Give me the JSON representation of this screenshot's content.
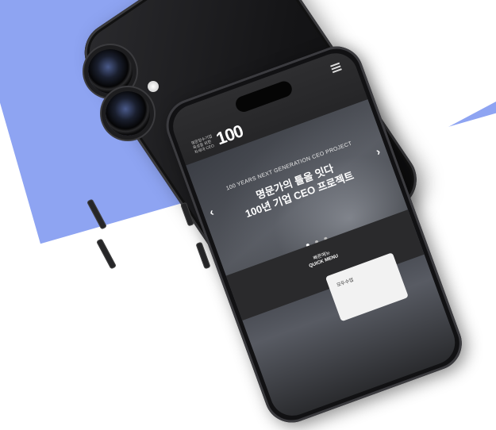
{
  "background": {
    "color": "#8ea4f2"
  },
  "site": {
    "logo_small": "명문장수기업 육성을 위한 차세대 CEO",
    "logo_number": "100",
    "subtitle": "100 YEARS NEXT GENERATION CEO PROJECT",
    "headline_line1": "명문가의 틀을 잇다",
    "headline_line2": "100년 기업 CEO 프로젝트",
    "arrow_prev": "‹",
    "arrow_next": "›",
    "slides_total": 3,
    "slide_active": 1
  },
  "quick_menu": {
    "label_ko": "빠른메뉴",
    "label_en": "QUICK MENU",
    "item_label": "모두수업"
  },
  "icons": [
    "menu-icon",
    "camera-lens-icon",
    "flash-icon",
    "chevron-left-icon",
    "chevron-right-icon"
  ]
}
